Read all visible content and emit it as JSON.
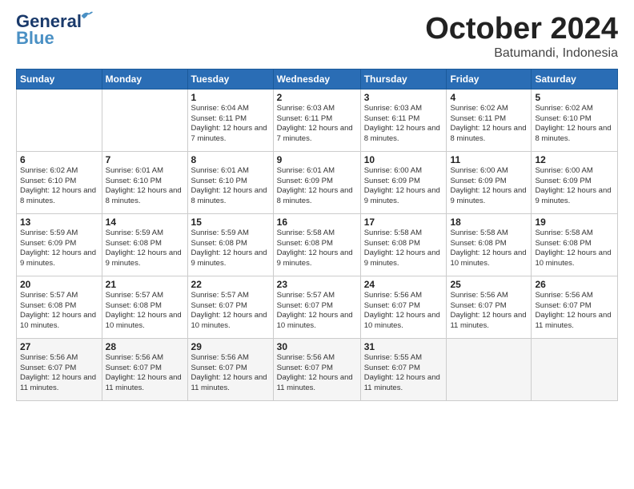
{
  "logo": {
    "general": "General",
    "blue": "Blue"
  },
  "header": {
    "month": "October 2024",
    "location": "Batumandi, Indonesia"
  },
  "weekdays": [
    "Sunday",
    "Monday",
    "Tuesday",
    "Wednesday",
    "Thursday",
    "Friday",
    "Saturday"
  ],
  "weeks": [
    [
      {
        "day": "",
        "sunrise": "",
        "sunset": "",
        "daylight": ""
      },
      {
        "day": "",
        "sunrise": "",
        "sunset": "",
        "daylight": ""
      },
      {
        "day": "1",
        "sunrise": "Sunrise: 6:04 AM",
        "sunset": "Sunset: 6:11 PM",
        "daylight": "Daylight: 12 hours and 7 minutes."
      },
      {
        "day": "2",
        "sunrise": "Sunrise: 6:03 AM",
        "sunset": "Sunset: 6:11 PM",
        "daylight": "Daylight: 12 hours and 7 minutes."
      },
      {
        "day": "3",
        "sunrise": "Sunrise: 6:03 AM",
        "sunset": "Sunset: 6:11 PM",
        "daylight": "Daylight: 12 hours and 8 minutes."
      },
      {
        "day": "4",
        "sunrise": "Sunrise: 6:02 AM",
        "sunset": "Sunset: 6:11 PM",
        "daylight": "Daylight: 12 hours and 8 minutes."
      },
      {
        "day": "5",
        "sunrise": "Sunrise: 6:02 AM",
        "sunset": "Sunset: 6:10 PM",
        "daylight": "Daylight: 12 hours and 8 minutes."
      }
    ],
    [
      {
        "day": "6",
        "sunrise": "Sunrise: 6:02 AM",
        "sunset": "Sunset: 6:10 PM",
        "daylight": "Daylight: 12 hours and 8 minutes."
      },
      {
        "day": "7",
        "sunrise": "Sunrise: 6:01 AM",
        "sunset": "Sunset: 6:10 PM",
        "daylight": "Daylight: 12 hours and 8 minutes."
      },
      {
        "day": "8",
        "sunrise": "Sunrise: 6:01 AM",
        "sunset": "Sunset: 6:10 PM",
        "daylight": "Daylight: 12 hours and 8 minutes."
      },
      {
        "day": "9",
        "sunrise": "Sunrise: 6:01 AM",
        "sunset": "Sunset: 6:09 PM",
        "daylight": "Daylight: 12 hours and 8 minutes."
      },
      {
        "day": "10",
        "sunrise": "Sunrise: 6:00 AM",
        "sunset": "Sunset: 6:09 PM",
        "daylight": "Daylight: 12 hours and 9 minutes."
      },
      {
        "day": "11",
        "sunrise": "Sunrise: 6:00 AM",
        "sunset": "Sunset: 6:09 PM",
        "daylight": "Daylight: 12 hours and 9 minutes."
      },
      {
        "day": "12",
        "sunrise": "Sunrise: 6:00 AM",
        "sunset": "Sunset: 6:09 PM",
        "daylight": "Daylight: 12 hours and 9 minutes."
      }
    ],
    [
      {
        "day": "13",
        "sunrise": "Sunrise: 5:59 AM",
        "sunset": "Sunset: 6:09 PM",
        "daylight": "Daylight: 12 hours and 9 minutes."
      },
      {
        "day": "14",
        "sunrise": "Sunrise: 5:59 AM",
        "sunset": "Sunset: 6:08 PM",
        "daylight": "Daylight: 12 hours and 9 minutes."
      },
      {
        "day": "15",
        "sunrise": "Sunrise: 5:59 AM",
        "sunset": "Sunset: 6:08 PM",
        "daylight": "Daylight: 12 hours and 9 minutes."
      },
      {
        "day": "16",
        "sunrise": "Sunrise: 5:58 AM",
        "sunset": "Sunset: 6:08 PM",
        "daylight": "Daylight: 12 hours and 9 minutes."
      },
      {
        "day": "17",
        "sunrise": "Sunrise: 5:58 AM",
        "sunset": "Sunset: 6:08 PM",
        "daylight": "Daylight: 12 hours and 9 minutes."
      },
      {
        "day": "18",
        "sunrise": "Sunrise: 5:58 AM",
        "sunset": "Sunset: 6:08 PM",
        "daylight": "Daylight: 12 hours and 10 minutes."
      },
      {
        "day": "19",
        "sunrise": "Sunrise: 5:58 AM",
        "sunset": "Sunset: 6:08 PM",
        "daylight": "Daylight: 12 hours and 10 minutes."
      }
    ],
    [
      {
        "day": "20",
        "sunrise": "Sunrise: 5:57 AM",
        "sunset": "Sunset: 6:08 PM",
        "daylight": "Daylight: 12 hours and 10 minutes."
      },
      {
        "day": "21",
        "sunrise": "Sunrise: 5:57 AM",
        "sunset": "Sunset: 6:08 PM",
        "daylight": "Daylight: 12 hours and 10 minutes."
      },
      {
        "day": "22",
        "sunrise": "Sunrise: 5:57 AM",
        "sunset": "Sunset: 6:07 PM",
        "daylight": "Daylight: 12 hours and 10 minutes."
      },
      {
        "day": "23",
        "sunrise": "Sunrise: 5:57 AM",
        "sunset": "Sunset: 6:07 PM",
        "daylight": "Daylight: 12 hours and 10 minutes."
      },
      {
        "day": "24",
        "sunrise": "Sunrise: 5:56 AM",
        "sunset": "Sunset: 6:07 PM",
        "daylight": "Daylight: 12 hours and 10 minutes."
      },
      {
        "day": "25",
        "sunrise": "Sunrise: 5:56 AM",
        "sunset": "Sunset: 6:07 PM",
        "daylight": "Daylight: 12 hours and 11 minutes."
      },
      {
        "day": "26",
        "sunrise": "Sunrise: 5:56 AM",
        "sunset": "Sunset: 6:07 PM",
        "daylight": "Daylight: 12 hours and 11 minutes."
      }
    ],
    [
      {
        "day": "27",
        "sunrise": "Sunrise: 5:56 AM",
        "sunset": "Sunset: 6:07 PM",
        "daylight": "Daylight: 12 hours and 11 minutes."
      },
      {
        "day": "28",
        "sunrise": "Sunrise: 5:56 AM",
        "sunset": "Sunset: 6:07 PM",
        "daylight": "Daylight: 12 hours and 11 minutes."
      },
      {
        "day": "29",
        "sunrise": "Sunrise: 5:56 AM",
        "sunset": "Sunset: 6:07 PM",
        "daylight": "Daylight: 12 hours and 11 minutes."
      },
      {
        "day": "30",
        "sunrise": "Sunrise: 5:56 AM",
        "sunset": "Sunset: 6:07 PM",
        "daylight": "Daylight: 12 hours and 11 minutes."
      },
      {
        "day": "31",
        "sunrise": "Sunrise: 5:55 AM",
        "sunset": "Sunset: 6:07 PM",
        "daylight": "Daylight: 12 hours and 11 minutes."
      },
      {
        "day": "",
        "sunrise": "",
        "sunset": "",
        "daylight": ""
      },
      {
        "day": "",
        "sunrise": "",
        "sunset": "",
        "daylight": ""
      }
    ]
  ]
}
